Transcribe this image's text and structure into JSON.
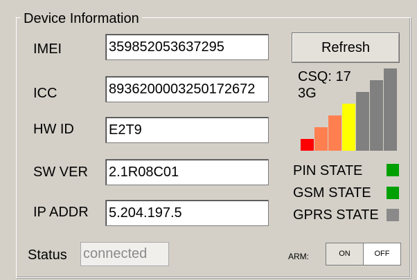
{
  "group": {
    "title": "Device Information"
  },
  "fields": {
    "imei": {
      "label": "IMEI",
      "value": "359852053637295"
    },
    "icc": {
      "label": "ICC",
      "value": "89362000032501726 72"
    },
    "hwid": {
      "label": "HW ID",
      "value": "E2T9"
    },
    "swver": {
      "label": "SW VER",
      "value": "2.1R08C01"
    },
    "ipaddr": {
      "label": "IP ADDR",
      "value": "5.204.197.5"
    }
  },
  "refresh_label": "Refresh",
  "signal": {
    "csq_text": "CSQ: 17",
    "network": "3G",
    "bars": [
      {
        "color": "#ff0000",
        "level": 1
      },
      {
        "color": "#ff7f50",
        "level": 2
      },
      {
        "color": "#ff7f50",
        "level": 3
      },
      {
        "color": "#ffff00",
        "level": 4
      },
      {
        "color": "#808080",
        "level": 5
      },
      {
        "color": "#808080",
        "level": 6
      },
      {
        "color": "#808080",
        "level": 7
      }
    ]
  },
  "states": {
    "pin": {
      "label": "PIN STATE",
      "color": "#00a000"
    },
    "gsm": {
      "label": "GSM STATE",
      "color": "#00a000"
    },
    "gprs": {
      "label": "GPRS STATE",
      "color": "#8a8a8a"
    }
  },
  "status": {
    "label": "Status",
    "value": "connected"
  },
  "arm": {
    "label": "ARM:",
    "on": "ON",
    "off": "OFF"
  }
}
